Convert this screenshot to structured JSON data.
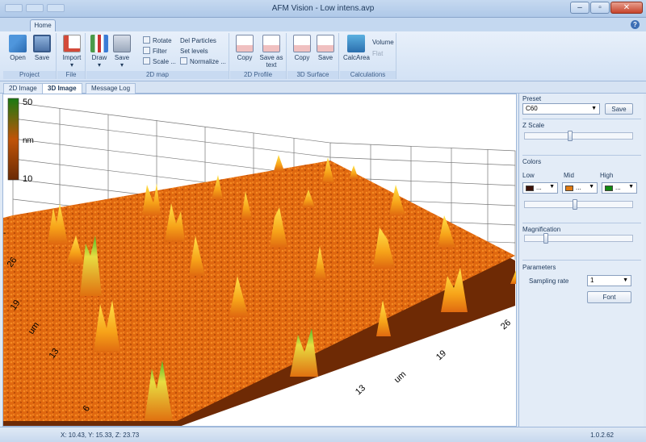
{
  "window": {
    "title": "AFM Vision - Low intens.avp"
  },
  "ribbon": {
    "tab": "Home",
    "groups": [
      {
        "label": "Project"
      },
      {
        "label": "File"
      },
      {
        "label": "2D map"
      },
      {
        "label": "2D Profile"
      },
      {
        "label": "3D Surface"
      },
      {
        "label": "Calculations"
      }
    ],
    "buttons": {
      "open": "Open",
      "save": "Save",
      "import": "Import",
      "draw": "Draw",
      "save2d": "Save",
      "rotate": "Rotate",
      "filter": "Filter",
      "scale": "Scale ...",
      "del_particles": "Del Particles",
      "set_levels": "Set levels",
      "normalize": "Normalize ...",
      "profile_copy": "Copy",
      "save_as_text": "Save as\ntext",
      "surface_copy": "Copy",
      "surface_save": "Save",
      "calcarea": "CalcArea",
      "volume": "Volume",
      "flat": "Flat"
    }
  },
  "doc_tabs": [
    "2D Image",
    "3D Image",
    "Message Log"
  ],
  "plot": {
    "colorbar": {
      "max": "50",
      "unit": "nm",
      "min": "10",
      "colors": [
        "#1a7a12",
        "#c05408",
        "#6a2a05"
      ]
    },
    "left_axis": {
      "unit": "um",
      "ticks": [
        "26",
        "19",
        "13",
        "6"
      ]
    },
    "bottom_axis": {
      "unit": "um",
      "ticks": [
        "13",
        "19",
        "26"
      ]
    }
  },
  "panel": {
    "preset_label": "Preset",
    "preset_value": "C60",
    "save_button": "Save",
    "zscale_label": "Z Scale",
    "zscale_level": 0.42,
    "colors_label": "Colors",
    "low_label": "Low",
    "mid_label": "Mid",
    "high_label": "High",
    "low_color": "#3c1208",
    "mid_color": "#e07a10",
    "high_color": "#128a10",
    "colors_level": 0.47,
    "magnification_label": "Magnification",
    "magnification_level": 0.18,
    "parameters_label": "Parameters",
    "sampling_label": "Sampling rate",
    "sampling_value": "1",
    "font_button": "Font"
  },
  "status": {
    "coords": "X: 10.43, Y: 15.33, Z: 23.73",
    "version": "1.0.2.62"
  }
}
